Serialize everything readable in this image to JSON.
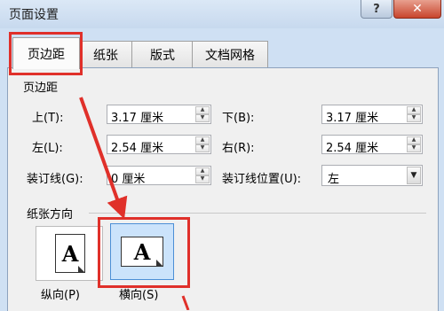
{
  "window": {
    "title": "页面设置",
    "help_label": "?",
    "close_label": "✕"
  },
  "tabs": [
    {
      "label": "页边距",
      "active": true
    },
    {
      "label": "纸张",
      "active": false
    },
    {
      "label": "版式",
      "active": false
    },
    {
      "label": "文档网格",
      "active": false
    }
  ],
  "margins": {
    "section_title": "页边距",
    "top": {
      "label": "上(T):",
      "value": "3.17 厘米"
    },
    "bottom": {
      "label": "下(B):",
      "value": "3.17 厘米"
    },
    "left": {
      "label": "左(L):",
      "value": "2.54 厘米"
    },
    "right": {
      "label": "右(R):",
      "value": "2.54 厘米"
    },
    "gutter": {
      "label": "装订线(G):",
      "value": "0 厘米"
    },
    "gutter_position": {
      "label": "装订线位置(U):",
      "value": "左"
    }
  },
  "orientation": {
    "section_title": "纸张方向",
    "portrait": {
      "label": "纵向(P)",
      "icon_letter": "A"
    },
    "landscape": {
      "label": "横向(S)",
      "icon_letter": "A",
      "selected": true
    }
  },
  "colors": {
    "highlight": "#e0302a",
    "selected_bg": "#cbe3fb"
  }
}
